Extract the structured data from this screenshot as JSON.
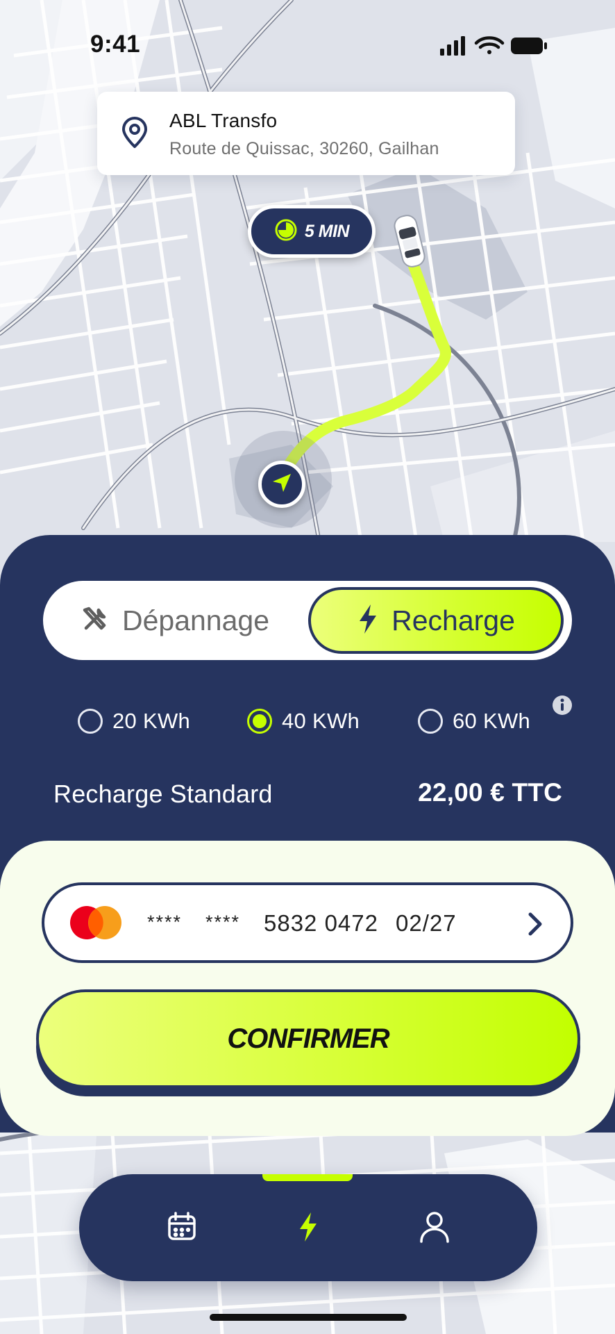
{
  "status_bar": {
    "time": "9:41"
  },
  "destination": {
    "name": "ABL Transfo",
    "address": "Route de Quissac, 30260, Gailhan"
  },
  "eta": {
    "label": "5 MIN"
  },
  "service_toggle": {
    "options": [
      {
        "label": "Dépannage",
        "icon": "tools-icon",
        "selected": false
      },
      {
        "label": "Recharge",
        "icon": "lightning-icon",
        "selected": true
      }
    ]
  },
  "energy_options": [
    {
      "label": "20 KWh",
      "selected": false
    },
    {
      "label": "40 KWh",
      "selected": true
    },
    {
      "label": "60 KWh",
      "selected": false
    }
  ],
  "plan": {
    "name": "Recharge Standard",
    "price": "22,00 € TTC"
  },
  "payment": {
    "brand_icon": "mastercard-logo",
    "mask_1": "****",
    "mask_2": "****",
    "number": "5832 0472",
    "expiry": "02/27"
  },
  "confirm": {
    "label": "CONFIRMER"
  },
  "tab_bar": {
    "tabs": [
      {
        "icon": "calendar-icon",
        "active": false
      },
      {
        "icon": "lightning-icon",
        "active": true
      },
      {
        "icon": "user-icon",
        "active": false
      }
    ]
  },
  "colors": {
    "navy": "#26345f",
    "accent_lime": "#c6ff00",
    "route": "#d9ff3a",
    "panel_cream": "#f8fded"
  }
}
